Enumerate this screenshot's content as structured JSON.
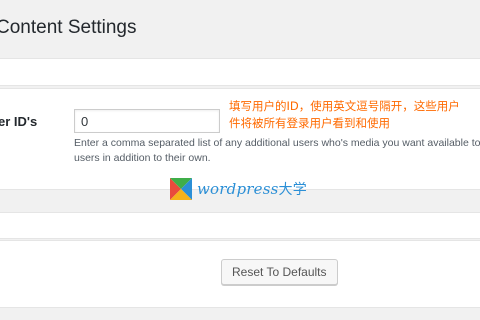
{
  "page": {
    "title": "Content Settings"
  },
  "setting": {
    "label": "er ID's",
    "input_value": "0",
    "description": "Enter a comma separated list of any additional users who's media you want available to users in addition to their own."
  },
  "annotation": {
    "line1": "填写用户的ID，使用英文逗号隔开，这些用户",
    "line2": "件将被所有登录用户看到和使用",
    "color": "#ff6a00"
  },
  "watermark": {
    "text": "wordpress",
    "text_cn": "大学"
  },
  "actions": {
    "reset_label": "Reset To Defaults"
  },
  "colors": {
    "background": "#f1f1f1",
    "panel": "#ffffff",
    "annotation": "#ff6a00",
    "watermark_blue": "#2b8fd6"
  }
}
